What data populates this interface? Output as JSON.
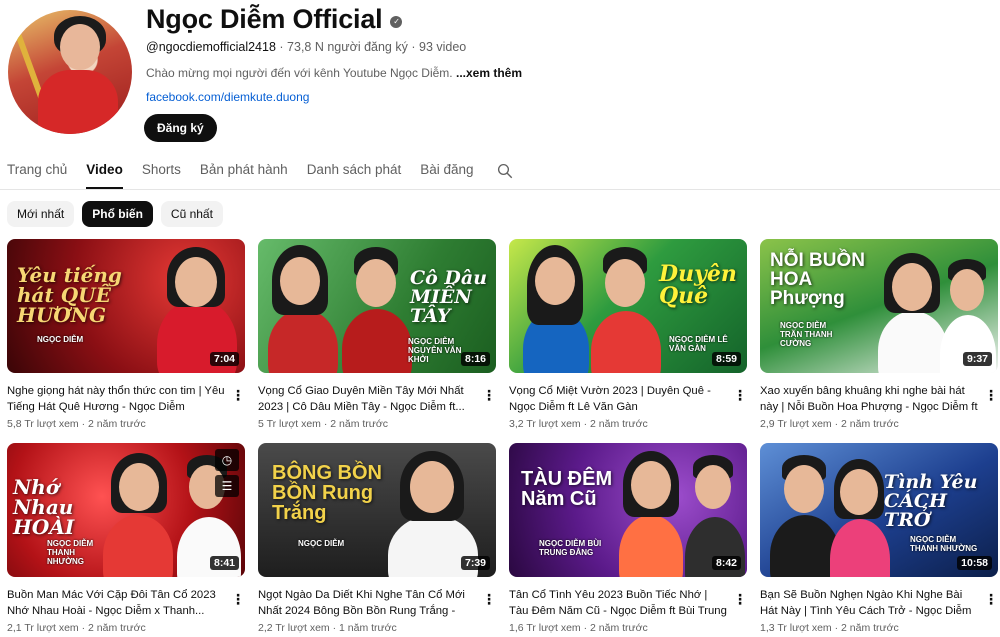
{
  "channel": {
    "name": "Ngọc Diễm Official",
    "handle": "@ngocdiemofficial2418",
    "subscribers": "73,8 N người đăng ký",
    "video_count": "93 video",
    "separator": "·",
    "description": "Chào mừng mọi người đến với kênh Youtube Ngọc Diễm.",
    "more_label": "...xem thêm",
    "link": "facebook.com/diemkute.duong",
    "subscribe_label": "Đăng ký",
    "verified_icon": "check-icon"
  },
  "tabs": [
    {
      "label": "Trang chủ",
      "active": false
    },
    {
      "label": "Video",
      "active": true
    },
    {
      "label": "Shorts",
      "active": false
    },
    {
      "label": "Bản phát hành",
      "active": false
    },
    {
      "label": "Danh sách phát",
      "active": false
    },
    {
      "label": "Bài đăng",
      "active": false
    }
  ],
  "filters": [
    {
      "label": "Mới nhất",
      "active": false
    },
    {
      "label": "Phổ biến",
      "active": true
    },
    {
      "label": "Cũ nhất",
      "active": false
    }
  ],
  "videos": [
    {
      "title": "Nghe giọng hát này thổn thức con tim | Yêu Tiếng Hát Quê Hương - Ngọc Diễm",
      "views": "5,8 Tr lượt xem",
      "age": "2 năm trước",
      "duration": "7:04",
      "thumb_title": "Yêu tiếng hát QUÊ HƯƠNG",
      "thumb_sub": "NGỌC DIỄM",
      "bg": "#8b0f14"
    },
    {
      "title": "Vọng Cổ Giao Duyên Miền Tây Mới Nhất 2023 | Cô Dâu Miền Tây - Ngọc Diễm ft...",
      "views": "5 Tr lượt xem",
      "age": "2 năm trước",
      "duration": "8:16",
      "thumb_title": "Cô Dâu MIỀN TÂY",
      "thumb_sub": "NGỌC DIỄM NGUYỄN VĂN KHỞI",
      "bg": "#2e7d32"
    },
    {
      "title": "Vọng Cổ Miệt Vườn 2023 | Duyên Quê - Ngọc Diễm ft Lê Văn Gàn",
      "views": "3,2 Tr lượt xem",
      "age": "2 năm trước",
      "duration": "8:59",
      "thumb_title": "Duyên Quê",
      "thumb_sub": "NGỌC DIỄM LÊ VĂN GÀN",
      "bg": "#1b8a3a"
    },
    {
      "title": "Xao xuyến bâng khuâng khi nghe bài hát này | Nỗi Buồn Hoa Phượng - Ngọc Diễm ft Trần...",
      "views": "2,9 Tr lượt xem",
      "age": "2 năm trước",
      "duration": "9:37",
      "thumb_title": "NỖI BUỒN HOA Phượng",
      "thumb_sub": "NGỌC DIỄM TRẦN THANH CƯỜNG",
      "bg": "#2f8f3a"
    },
    {
      "title": "Buồn Man Mác Với Cặp Đôi Tân Cổ 2023 Nhớ Nhau Hoài - Ngọc Diễm x Thanh...",
      "views": "2,1 Tr lượt xem",
      "age": "2 năm trước",
      "duration": "8:41",
      "thumb_title": "Nhớ Nhau HOÀI",
      "thumb_sub": "NGỌC DIỄM THANH NHƯỜNG",
      "bg": "#b31217"
    },
    {
      "title": "Ngọt Ngào Da Diết Khi Nghe Tân Cổ Mới Nhất 2024 Bông Bồn Bồn Rung Trắng - Ngọ...",
      "views": "2,2 Tr lượt xem",
      "age": "1 năm trước",
      "duration": "7:39",
      "thumb_title": "BÔNG BỒN BỒN Rung Trắng",
      "thumb_sub": "NGỌC DIỄM",
      "bg": "#2b2b2b"
    },
    {
      "title": "Tân Cổ Tình Yêu 2023 Buồn Tiếc Nhớ | Tàu Đêm Năm Cũ - Ngọc Diễm ft Bùi Trung Đẳng",
      "views": "1,6 Tr lượt xem",
      "age": "2 năm trước",
      "duration": "8:42",
      "thumb_title": "TÀU ĐÊM Năm Cũ",
      "thumb_sub": "NGỌC DIỄM BÙI TRUNG ĐẲNG",
      "bg": "#5b1a8a"
    },
    {
      "title": "Bạn Sẽ Buồn Nghẹn Ngào Khi Nghe Bài Hát Này | Tình Yêu Cách Trở - Ngọc Diễm x...",
      "views": "1,3 Tr lượt xem",
      "age": "2 năm trước",
      "duration": "10:58",
      "thumb_title": "Tình Yêu CÁCH TRỞ",
      "thumb_sub": "NGỌC DIỄM THANH NHƯỜNG",
      "bg": "#1d3f8f"
    }
  ]
}
